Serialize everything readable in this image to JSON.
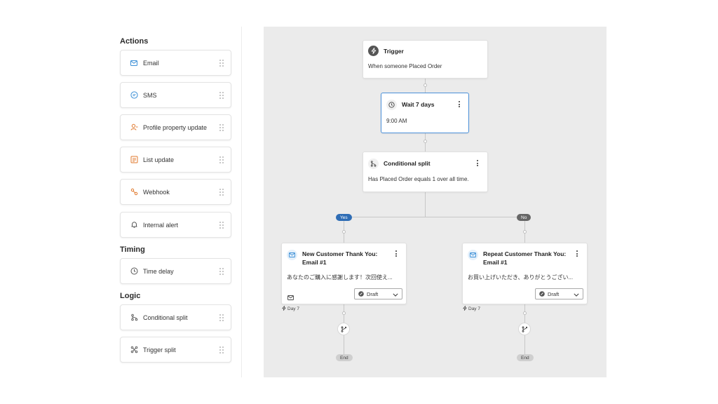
{
  "sidebar": {
    "sections": {
      "actions": "Actions",
      "timing": "Timing",
      "logic": "Logic"
    },
    "items": [
      {
        "label": "Email",
        "icon": "email-icon"
      },
      {
        "label": "SMS",
        "icon": "sms-icon"
      },
      {
        "label": "Profile property update",
        "icon": "profile-icon"
      },
      {
        "label": "List update",
        "icon": "list-icon"
      },
      {
        "label": "Webhook",
        "icon": "webhook-icon"
      },
      {
        "label": "Internal alert",
        "icon": "bell-icon"
      },
      {
        "label": "Time delay",
        "icon": "clock-icon"
      },
      {
        "label": "Conditional split",
        "icon": "split-icon"
      },
      {
        "label": "Trigger split",
        "icon": "trigger-split-icon"
      }
    ]
  },
  "flow": {
    "trigger": {
      "title": "Trigger",
      "desc": "When someone Placed Order"
    },
    "wait": {
      "title": "Wait 7 days",
      "desc": "9:00 AM"
    },
    "split": {
      "title": "Conditional split",
      "desc": "Has Placed Order equals 1 over all time."
    },
    "branches": {
      "yes": "Yes",
      "no": "No"
    },
    "email_left": {
      "title_line1": "New Customer Thank You:",
      "title_line2": "Email #1",
      "desc": "あなたのご購入に感謝します！次回使え...",
      "status": "Draft",
      "day": "Day 7"
    },
    "email_right": {
      "title_line1": "Repeat Customer Thank You:",
      "title_line2": "Email #1",
      "desc": "お買い上げいただき、ありがとうござい...",
      "status": "Draft",
      "day": "Day 7"
    },
    "end_label": "End"
  },
  "colors": {
    "accent": "#2f6db5",
    "selected_border": "#4a90d9",
    "canvas_bg": "#ebebeb"
  }
}
